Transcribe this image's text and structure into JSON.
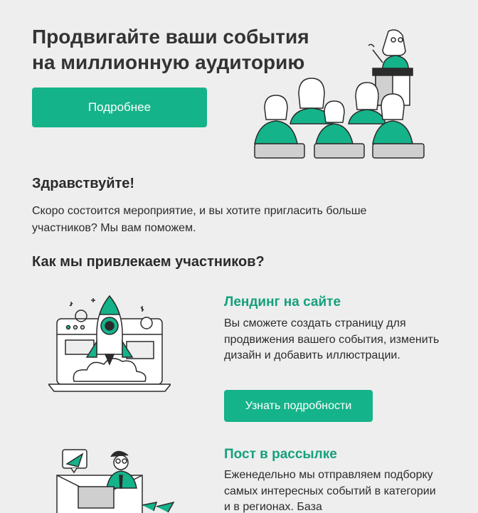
{
  "hero": {
    "title_line1": "Продвигайте ваши события",
    "title_line2": "на миллионную аудиторию",
    "button_label": "Подробнее"
  },
  "greeting": "Здравствуйте!",
  "intro": "Скоро состоится мероприятие, и вы хотите пригласить больше участников? Мы вам поможем.",
  "how_title": "Как мы привлекаем участников?",
  "features": [
    {
      "title": "Лендинг на сайте",
      "text": "Вы сможете создать страницу для продвижения вашего события, изменить дизайн и добавить иллюстрации.",
      "button_label": "Узнать подробности"
    },
    {
      "title": "Пост в рассылке",
      "text": "Еженедельно мы отправляем подборку самых интересных событий в категории и в регионах. База"
    }
  ],
  "colors": {
    "accent": "#15b38a",
    "accent_text": "#15a07c",
    "background": "#eeeeee",
    "text": "#2b2b2b"
  },
  "icons": [
    "audience-illustration",
    "rocket-laptop-illustration",
    "mail-person-illustration"
  ]
}
